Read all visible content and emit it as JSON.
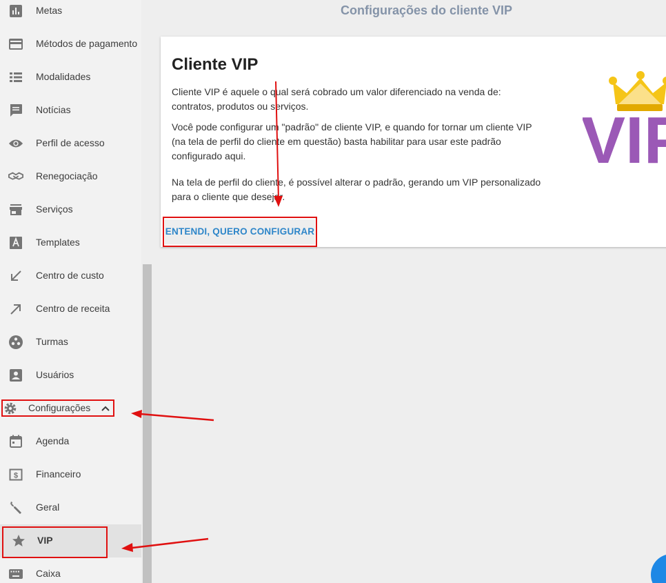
{
  "sidebar": {
    "items": [
      {
        "label": "Metas",
        "icon": "bar-chart-icon"
      },
      {
        "label": "Métodos de pagamento",
        "icon": "credit-card-icon"
      },
      {
        "label": "Modalidades",
        "icon": "list-icon"
      },
      {
        "label": "Notícias",
        "icon": "chat-icon"
      },
      {
        "label": "Perfil de acesso",
        "icon": "eye-icon"
      },
      {
        "label": "Renegociação",
        "icon": "handshake-icon"
      },
      {
        "label": "Serviços",
        "icon": "store-icon"
      },
      {
        "label": "Templates",
        "icon": "font-icon"
      },
      {
        "label": "Centro de custo",
        "icon": "arrow-down-left-icon"
      },
      {
        "label": "Centro de receita",
        "icon": "arrow-up-right-icon"
      },
      {
        "label": "Turmas",
        "icon": "group-icon"
      },
      {
        "label": "Usuários",
        "icon": "account-box-icon"
      }
    ],
    "config_section": {
      "label": "Configurações",
      "icon": "gear-icon",
      "expanded": true
    },
    "sub_items": [
      {
        "label": "Agenda",
        "icon": "calendar-icon"
      },
      {
        "label": "Financeiro",
        "icon": "money-icon"
      },
      {
        "label": "Geral",
        "icon": "wrench-icon"
      },
      {
        "label": "VIP",
        "icon": "star-icon",
        "active": true
      },
      {
        "label": "Caixa",
        "icon": "keyboard-icon"
      }
    ]
  },
  "main": {
    "page_title": "Configurações do cliente VIP",
    "card": {
      "title": "Cliente VIP",
      "paragraph1": "Cliente VIP é aquele o qual será cobrado um valor diferenciado na venda de: contratos, produtos ou serviços.",
      "paragraph2": "Você pode configurar um \"padrão\" de cliente VIP, e quando for tornar um cliente VIP (na tela de perfil do cliente em questão) basta habilitar para usar este padrão configurado aqui.",
      "paragraph3": "Na tela de perfil do cliente, é possível alterar o padrão, gerando um VIP personalizado para o cliente que desejar.",
      "button_label": "ENTENDI, QUERO CONFIGURAR",
      "logo_text": "VIP"
    }
  },
  "colors": {
    "accent_blue": "#2e86c9",
    "annotation_red": "#e01010",
    "vip_purple": "#9b59b6",
    "crown_gold": "#f5c518",
    "title_gray": "#8493a8"
  }
}
